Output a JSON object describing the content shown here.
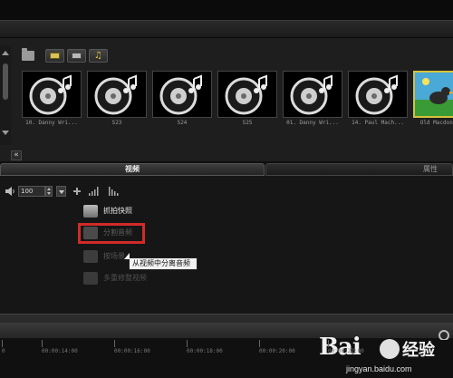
{
  "library": {
    "filters": [
      {
        "name": "video-filter",
        "icon": "video-icon"
      },
      {
        "name": "image-filter",
        "icon": "image-icon"
      },
      {
        "name": "audio-filter",
        "icon": "music-note-icon"
      }
    ],
    "thumbnails": [
      {
        "label": "10. Danny Wri...",
        "icon": "audio-disc-icon",
        "selected": false
      },
      {
        "label": "S23",
        "icon": "audio-disc-icon",
        "selected": false
      },
      {
        "label": "S24",
        "icon": "audio-disc-icon",
        "selected": false
      },
      {
        "label": "S25",
        "icon": "audio-disc-icon",
        "selected": false
      },
      {
        "label": "01. Danny Wri...",
        "icon": "audio-disc-icon",
        "selected": false
      },
      {
        "label": "14. Paul Mach...",
        "icon": "audio-disc-icon",
        "selected": false
      },
      {
        "label": "Old Macdona...",
        "icon": "video-thumbnail-icon",
        "selected": true
      }
    ],
    "collapse_glyph": "«"
  },
  "tabs": {
    "video": "视频",
    "properties": "属性"
  },
  "audio": {
    "volume": "100"
  },
  "options": {
    "snapshot": "抓拍快照",
    "split_audio": "分割音频",
    "scene_split": "按场景",
    "multi_trim": "多重修整视频"
  },
  "tooltip": "从视频中分离音频",
  "timeline": {
    "ticks": [
      "0",
      "00:00:14:00",
      "00:00:16:00",
      "00:00:18:00",
      "00:00:20:00",
      "00:00:22:00"
    ]
  },
  "watermark": {
    "logo": "Bai",
    "logo_cn": "经验",
    "url": "jingyan.baidu.com"
  },
  "colors": {
    "highlight": "#d22a2a",
    "selected_border": "#d6c23c"
  }
}
